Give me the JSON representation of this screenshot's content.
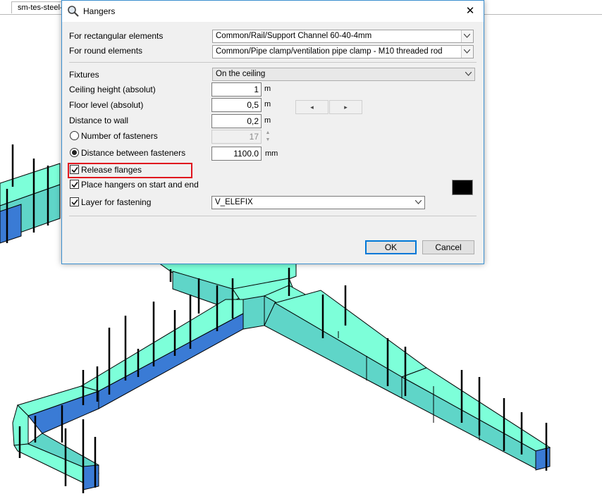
{
  "background_tab": {
    "label": "sm-tes-steel-p"
  },
  "dialog": {
    "title": "Hangers",
    "close_label": "✕",
    "fields": {
      "rect_label": "For rectangular elements",
      "rect_value": "Common/Rail/Support Channel 60-40-4mm",
      "round_label": "For round elements",
      "round_value": "Common/Pipe clamp/ventilation pipe clamp - M10 threaded rod",
      "fixtures_label": "Fixtures",
      "fixtures_value": "On the ceiling",
      "ceiling_label": "Ceiling height (absolut)",
      "ceiling_value": "1",
      "ceiling_unit": "m",
      "floor_label": "Floor level (absolut)",
      "floor_value": "0,5",
      "floor_unit": "m",
      "wall_label": "Distance to wall",
      "wall_value": "0,2",
      "wall_unit": "m",
      "nav_left": "◂",
      "nav_right": "▸",
      "num_fasteners_label": "Number of fasteners",
      "num_fasteners_value": "17",
      "dist_fasteners_label": "Distance between fasteners",
      "dist_fasteners_value": "1100.0",
      "dist_fasteners_unit": "mm",
      "release_flanges_label": "Release flanges",
      "place_hangers_label": "Place hangers on start and end",
      "layer_label": "Layer for fastening",
      "layer_value": "V_ELEFIX"
    },
    "state": {
      "mode_selected": "distance",
      "release_flanges_checked": true,
      "place_hangers_checked": true,
      "layer_checked": true,
      "layer_color": "#000000"
    },
    "buttons": {
      "ok": "OK",
      "cancel": "Cancel"
    }
  },
  "icons": [
    "search-icon",
    "close-icon",
    "chevron-down-icon",
    "checkmark-icon",
    "spin-up-icon",
    "spin-down-icon"
  ],
  "colors": {
    "duct_top": "#7dffd9",
    "duct_side": "#5fd5c8",
    "duct_dark": "#3a7bd5",
    "highlight": "#e0141e",
    "accent": "#0078d7"
  }
}
